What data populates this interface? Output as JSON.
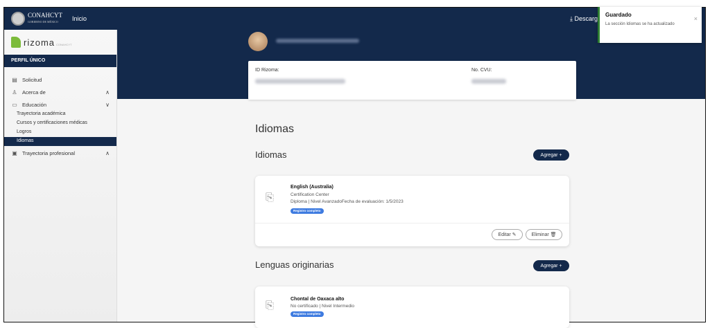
{
  "topbar": {
    "gov_logo_text": "CONAHCYT",
    "gov_logo_sub": "GOBIERNO DE MÉXICO",
    "inicio": "Inicio",
    "descarga": "⤓ Descarga"
  },
  "toast": {
    "title": "Guardado",
    "message": "La sección Idiomas se ha actualizado",
    "close": "×"
  },
  "sidebar": {
    "brand": "rizoma",
    "brand_sub": "CONAHCYT",
    "perfil": "PERFIL ÚNICO",
    "items": [
      {
        "icon": "document-icon",
        "glyph": "▤",
        "label": "Solicitud"
      },
      {
        "icon": "person-icon",
        "glyph": "♙",
        "label": "Acerca de",
        "chevron": "∧"
      },
      {
        "icon": "book-icon",
        "glyph": "▭",
        "label": "Educación",
        "chevron": "∨"
      }
    ],
    "education_sub": [
      "Trayectoria académica",
      "Cursos y certificaciones médicas",
      "Logros",
      "Idiomas"
    ],
    "professional": {
      "icon": "id-badge-icon",
      "glyph": "▣",
      "label": "Trayectoria profesional",
      "chevron": "∧"
    }
  },
  "profile": {
    "id_label": "ID Rizoma:",
    "cvu_label": "No. CVU:"
  },
  "main": {
    "title": "Idiomas",
    "idiomas_section": {
      "heading": "Idiomas",
      "add": "Agregar +",
      "card": {
        "title": "English (Australia)",
        "line1": "Certification Center",
        "line2": "Diploma | Nivel AvanzadoFecha de evaluación: 1/5/2023",
        "badge": "Registro completo",
        "edit": "Editar ✎",
        "delete": "Eliminar 🗑"
      }
    },
    "lenguas_section": {
      "heading": "Lenguas originarias",
      "add": "Agregar +",
      "card": {
        "title": "Chontal de Oaxaca alto",
        "line1": "No certificado | Nivel Intermedio",
        "badge": "Registro completo"
      }
    }
  }
}
